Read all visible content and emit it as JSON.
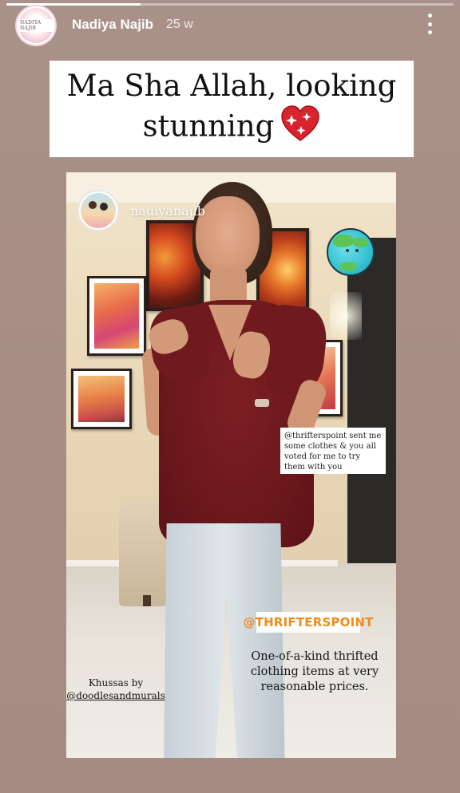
{
  "story": {
    "username": "Nadiya Najib",
    "time_ago": "25 w",
    "progress": 0.3,
    "avatar_text": "NADIYA NAJIB",
    "more_icon": "three-dots-vertical-icon"
  },
  "caption": {
    "text": "Ma Sha Allah, looking stunning",
    "emoji": "sparkling-heart-icon"
  },
  "photo": {
    "profile_sticker_name": "nadiyanajib",
    "earth_sticker": "earth-globe-icon",
    "note": "@thrifterspoint sent me some clothes & you all voted for me to try them with you",
    "mention": "@THRIFTERSPOINT",
    "promo": "One-of-a-kind thrifted clothing items at very reasonable prices.",
    "credit_line": "Khussas by",
    "credit_handle": "@doodlesandmurals"
  },
  "colors": {
    "background": "#a88e84",
    "mention_orange": "#f08b1c",
    "heart_red": "#d9232d"
  }
}
